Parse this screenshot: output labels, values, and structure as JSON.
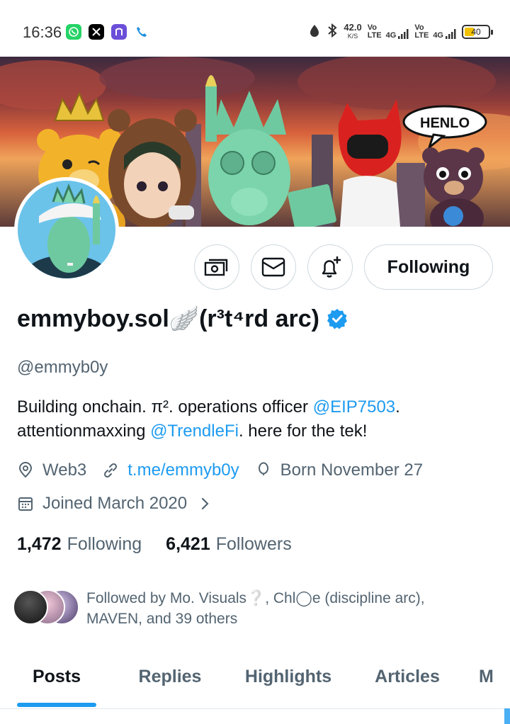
{
  "status_bar": {
    "time": "16:36",
    "apps": [
      "whatsapp-icon",
      "x-icon",
      "notion-calendar-icon",
      "phone-icon"
    ],
    "net_speed": "42.0",
    "net_speed_unit": "K/S",
    "sim1_type": "Vo\nLTE",
    "sim1_net": "4G",
    "sim2_type": "Vo\nLTE",
    "sim2_net": "4G",
    "battery": "40",
    "battery_level": 0.4,
    "battery_color": "#f2c200"
  },
  "banner": {
    "speech_bubble": "HENLO"
  },
  "actions": {
    "tip_icon": "money-icon",
    "message_icon": "mail-icon",
    "notify_icon": "bell-plus-icon",
    "following_label": "Following"
  },
  "profile": {
    "display_name": "emmyboy.sol🪽(r³t⁴rd arc)",
    "verified": true,
    "handle": "@emmyb0y",
    "bio": {
      "part1": "Building onchain. π². operations officer ",
      "mention1": "@EIP7503",
      "part2": ". attentionmaxxing ",
      "mention2": "@TrendleFi",
      "part3": ". here for the tek!"
    },
    "location": "Web3",
    "website": "t.me/emmyb0y",
    "birthday": "Born November 27",
    "joined": "Joined March 2020"
  },
  "counts": {
    "following_num": "1,472",
    "following_label": "Following",
    "followers_num": "6,421",
    "followers_label": "Followers"
  },
  "followed_by": {
    "text": "Followed by Mo. Visuals❔, Chl◯e (discipline arc), MAVEN, and 39 others"
  },
  "tabs": [
    {
      "label": "Posts",
      "active": true
    },
    {
      "label": "Replies",
      "active": false
    },
    {
      "label": "Highlights",
      "active": false
    },
    {
      "label": "Articles",
      "active": false
    },
    {
      "label": "M",
      "active": false
    }
  ],
  "colors": {
    "accent": "#1d9bf0",
    "text_primary": "#0f1419",
    "text_secondary": "#536471"
  }
}
